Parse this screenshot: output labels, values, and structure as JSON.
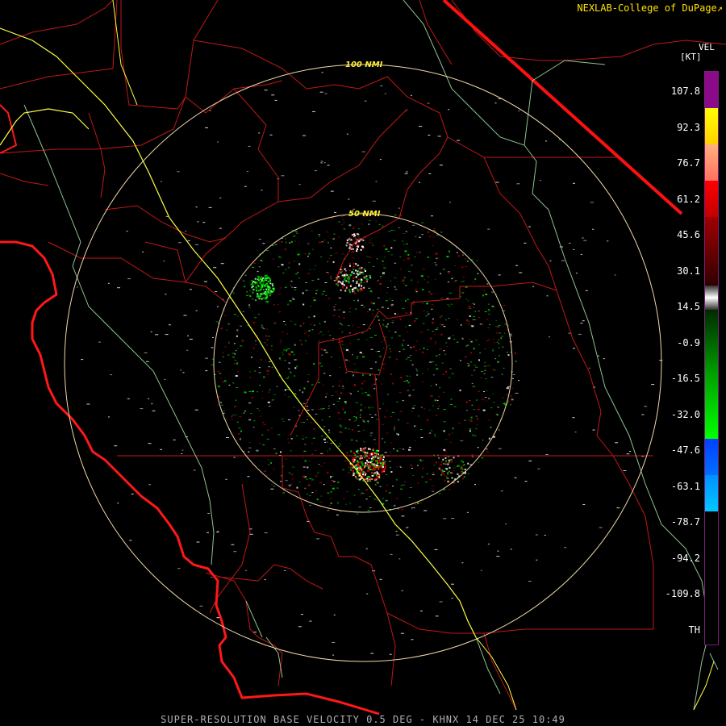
{
  "credit": "NEXLAB-College of DuPage",
  "product_footer": "SUPER-RESOLUTION BASE VELOCITY 0.5 DEG - KHNX 14 DEC 25 10:49",
  "legend": {
    "product": "VEL",
    "unit": "[KT]",
    "ticks": [
      "107.8",
      "92.3",
      "76.7",
      "61.2",
      "45.6",
      "30.1",
      "14.5",
      "-0.9",
      "-16.5",
      "-32.0",
      "-47.6",
      "-63.1",
      "-78.7",
      "-94.2",
      "-109.8",
      "TH"
    ],
    "colors": {
      "purple": "#8a0a8a",
      "yellow": "#ffff00",
      "orange": "#ff9a5c",
      "red": "#ff0000",
      "dark_red": "#5a0000",
      "gray": "#9a9a9a",
      "green": "#00ff00",
      "dark_green": "#005a00",
      "blue": "#0060ff",
      "cyan": "#00c8ff",
      "black": "#000000"
    }
  },
  "range_rings": [
    {
      "label": "100 NMI"
    },
    {
      "label": "50 NMI"
    }
  ],
  "colors": {
    "county_lines": "#c01818",
    "state_line": "#ff1010",
    "coastline": "#ff1818",
    "highway": "#ffff40",
    "roads": "#a6e6a6",
    "ring": "#f0d8a8"
  }
}
